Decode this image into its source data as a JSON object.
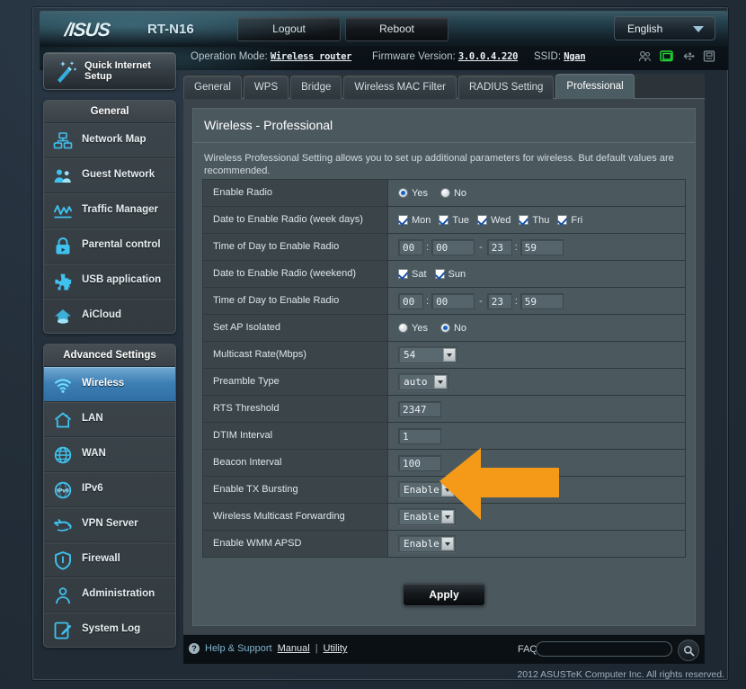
{
  "header": {
    "brand": "/ISUS",
    "model": "RT-N16",
    "logout_label": "Logout",
    "reboot_label": "Reboot",
    "language": "English",
    "accent_color": "#2f6ea4",
    "annotation_color": "#F59A18"
  },
  "infobar": {
    "operation_mode_label": "Operation Mode:",
    "operation_mode_value": "Wireless router",
    "firmware_label": "Firmware Version:",
    "firmware_value": "3.0.0.4.220",
    "ssid_label": "SSID:",
    "ssid_value": "Ngan",
    "status_icons": [
      {
        "name": "clients-icon",
        "active": false
      },
      {
        "name": "monitor-icon",
        "active": true
      },
      {
        "name": "usb-icon",
        "active": false
      },
      {
        "name": "printer-icon",
        "active": false
      }
    ]
  },
  "sidebar": {
    "quick_setup_label": "Quick Internet Setup",
    "general_title": "General",
    "general_items": [
      {
        "label": "Network Map",
        "icon": "network-map-icon"
      },
      {
        "label": "Guest Network",
        "icon": "guest-network-icon"
      },
      {
        "label": "Traffic Manager",
        "icon": "traffic-manager-icon"
      },
      {
        "label": "Parental control",
        "icon": "parental-control-icon"
      },
      {
        "label": "USB application",
        "icon": "usb-application-icon"
      },
      {
        "label": "AiCloud",
        "icon": "aicloud-icon"
      }
    ],
    "advanced_title": "Advanced Settings",
    "advanced_items": [
      {
        "label": "Wireless",
        "icon": "wireless-icon",
        "active": true
      },
      {
        "label": "LAN",
        "icon": "lan-icon",
        "active": false
      },
      {
        "label": "WAN",
        "icon": "wan-icon",
        "active": false
      },
      {
        "label": "IPv6",
        "icon": "ipv6-icon",
        "active": false
      },
      {
        "label": "VPN Server",
        "icon": "vpn-server-icon",
        "active": false
      },
      {
        "label": "Firewall",
        "icon": "firewall-icon",
        "active": false
      },
      {
        "label": "Administration",
        "icon": "administration-icon",
        "active": false
      },
      {
        "label": "System Log",
        "icon": "system-log-icon",
        "active": false
      }
    ]
  },
  "tabs": [
    {
      "label": "General",
      "active": false
    },
    {
      "label": "WPS",
      "active": false
    },
    {
      "label": "Bridge",
      "active": false
    },
    {
      "label": "Wireless MAC Filter",
      "active": false
    },
    {
      "label": "RADIUS Setting",
      "active": false
    },
    {
      "label": "Professional",
      "active": true
    }
  ],
  "panel": {
    "title": "Wireless - Professional",
    "description": "Wireless Professional Setting allows you to set up additional parameters for wireless. But default values are recommended.",
    "apply_label": "Apply"
  },
  "form": {
    "enable_radio": {
      "label": "Enable Radio",
      "yes_label": "Yes",
      "no_label": "No",
      "value": "Yes"
    },
    "date_weekdays": {
      "label": "Date to Enable Radio (week days)",
      "days": [
        {
          "label": "Mon",
          "checked": true
        },
        {
          "label": "Tue",
          "checked": true
        },
        {
          "label": "Wed",
          "checked": true
        },
        {
          "label": "Thu",
          "checked": true
        },
        {
          "label": "Fri",
          "checked": true
        }
      ]
    },
    "time_weekdays": {
      "label": "Time of Day to Enable Radio",
      "start_hour": "00",
      "start_min": "00",
      "end_hour": "23",
      "end_min": "59"
    },
    "date_weekend": {
      "label": "Date to Enable Radio (weekend)",
      "days": [
        {
          "label": "Sat",
          "checked": true
        },
        {
          "label": "Sun",
          "checked": true
        }
      ]
    },
    "time_weekend": {
      "label": "Time of Day to Enable Radio",
      "start_hour": "00",
      "start_min": "00",
      "end_hour": "23",
      "end_min": "59"
    },
    "ap_isolated": {
      "label": "Set AP Isolated",
      "yes_label": "Yes",
      "no_label": "No",
      "value": "No"
    },
    "multicast_rate": {
      "label": "Multicast Rate(Mbps)",
      "value": "54"
    },
    "preamble_type": {
      "label": "Preamble Type",
      "value": "auto"
    },
    "rts_threshold": {
      "label": "RTS Threshold",
      "value": "2347"
    },
    "dtim_interval": {
      "label": "DTIM Interval",
      "value": "1"
    },
    "beacon_interval": {
      "label": "Beacon Interval",
      "value": "100"
    },
    "tx_bursting": {
      "label": "Enable TX Bursting",
      "value": "Enable"
    },
    "multicast_forwarding": {
      "label": "Wireless Multicast Forwarding",
      "value": "Enable"
    },
    "wmm_apsd": {
      "label": "Enable WMM APSD",
      "value": "Enable"
    }
  },
  "footer": {
    "help_label": "Help & Support",
    "manual_label": "Manual",
    "separator": "|",
    "utility_label": "Utility",
    "faq_label": "FAQ",
    "faq_placeholder": "",
    "faq_value": "",
    "copyright": "2012 ASUSTeK Computer Inc. All rights reserved."
  }
}
